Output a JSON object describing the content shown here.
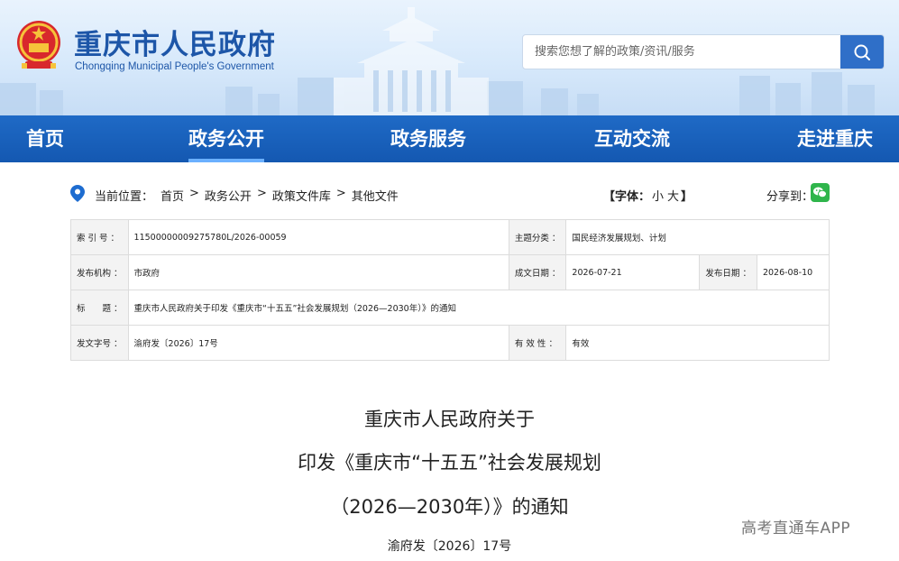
{
  "header": {
    "site_title": "重庆市人民政府",
    "site_subtitle": "Chongqing Municipal People's Government",
    "search_placeholder": "搜索您想了解的政策/资讯/服务"
  },
  "nav": {
    "items": [
      {
        "label": "首页",
        "active": false
      },
      {
        "label": "政务公开",
        "active": true
      },
      {
        "label": "政务服务",
        "active": false
      },
      {
        "label": "互动交流",
        "active": false
      },
      {
        "label": "走进重庆",
        "active": false
      }
    ]
  },
  "breadcrumb": {
    "label": "当前位置：",
    "items": [
      "首页",
      "政务公开",
      "政策文件库",
      "其他文件"
    ],
    "separator": ">"
  },
  "font_control": {
    "label": "【字体：",
    "small": "小",
    "large": "大",
    "close": "】"
  },
  "share": {
    "label": "分享到："
  },
  "meta": {
    "index_label": "索 引 号 ：",
    "index_value": "11500000009275780L/2026-00059",
    "topic_label": "主题分类 ：",
    "topic_value": "国民经济发展规划、计划",
    "issuer_label": "发布机构 ：",
    "issuer_value": "市政府",
    "written_label": "成文日期 ：",
    "written_value": "2026-07-21",
    "published_label": "发布日期 ：",
    "published_value": "2026-08-10",
    "title_label": "标　　题 ：",
    "title_value": "重庆市人民政府关于印发《重庆市“十五五”社会发展规划（2026—2030年）》的通知",
    "docno_label": "发文字号 ：",
    "docno_value": "渝府发〔2026〕17号",
    "validity_label": "有 效 性 ：",
    "validity_value": "有效"
  },
  "document": {
    "title_line1": "重庆市人民政府关于",
    "title_line2": "印发《重庆市“十五五”社会发展规划",
    "title_line3": "（2026—2030年）》的通知",
    "doc_number": "渝府发〔2026〕17号"
  },
  "watermark": "高考直通车APP",
  "colors": {
    "brand_blue": "#1d56a8",
    "nav_blue": "#1458b1",
    "search_button": "#2f6fc8",
    "wechat_green": "#2fb54b"
  }
}
